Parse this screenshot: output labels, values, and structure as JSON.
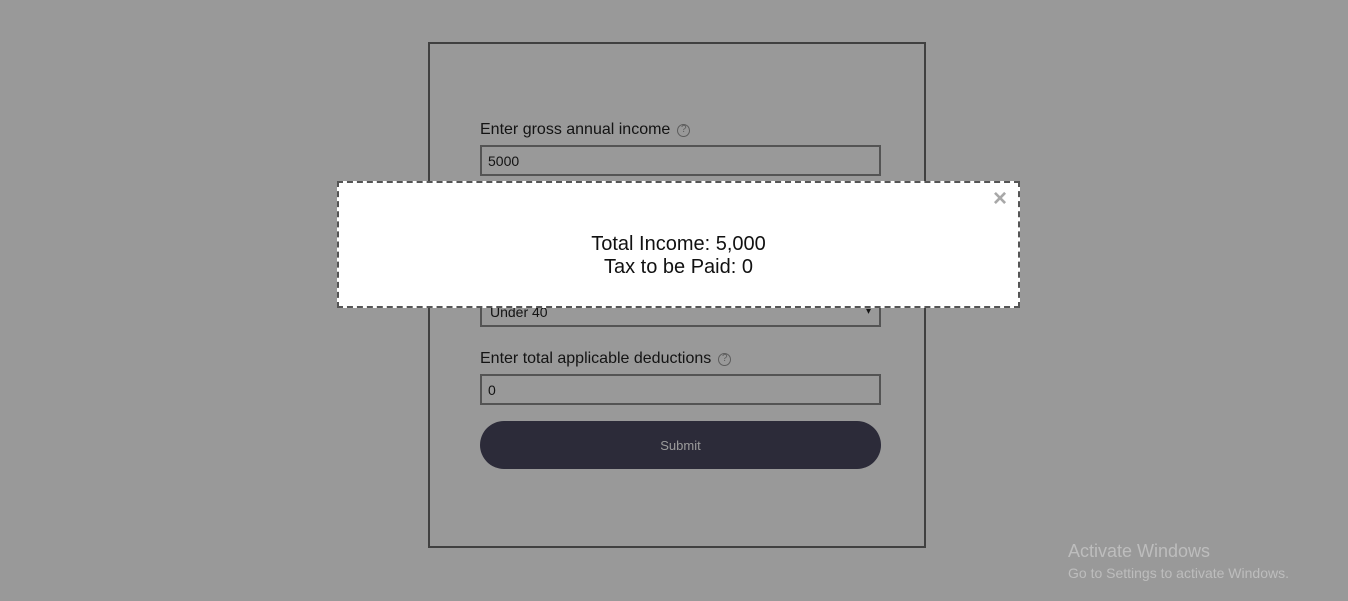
{
  "form": {
    "income_label": "Enter gross annual income",
    "income_value": "5000",
    "age_value": "Under 40",
    "deductions_label": "Enter total applicable deductions",
    "deductions_value": "0",
    "submit_label": "Submit",
    "help_glyph": "?"
  },
  "modal": {
    "close_glyph": "×",
    "total_income_text": "Total Income: 5,000",
    "tax_text": "Tax to be Paid: 0"
  },
  "watermark": {
    "title": "Activate Windows",
    "subtitle": "Go to Settings to activate Windows."
  },
  "colors": {
    "overlay": "rgba(0,0,0,0.4)",
    "button": "#4a4860",
    "modal_border": "#555555"
  }
}
